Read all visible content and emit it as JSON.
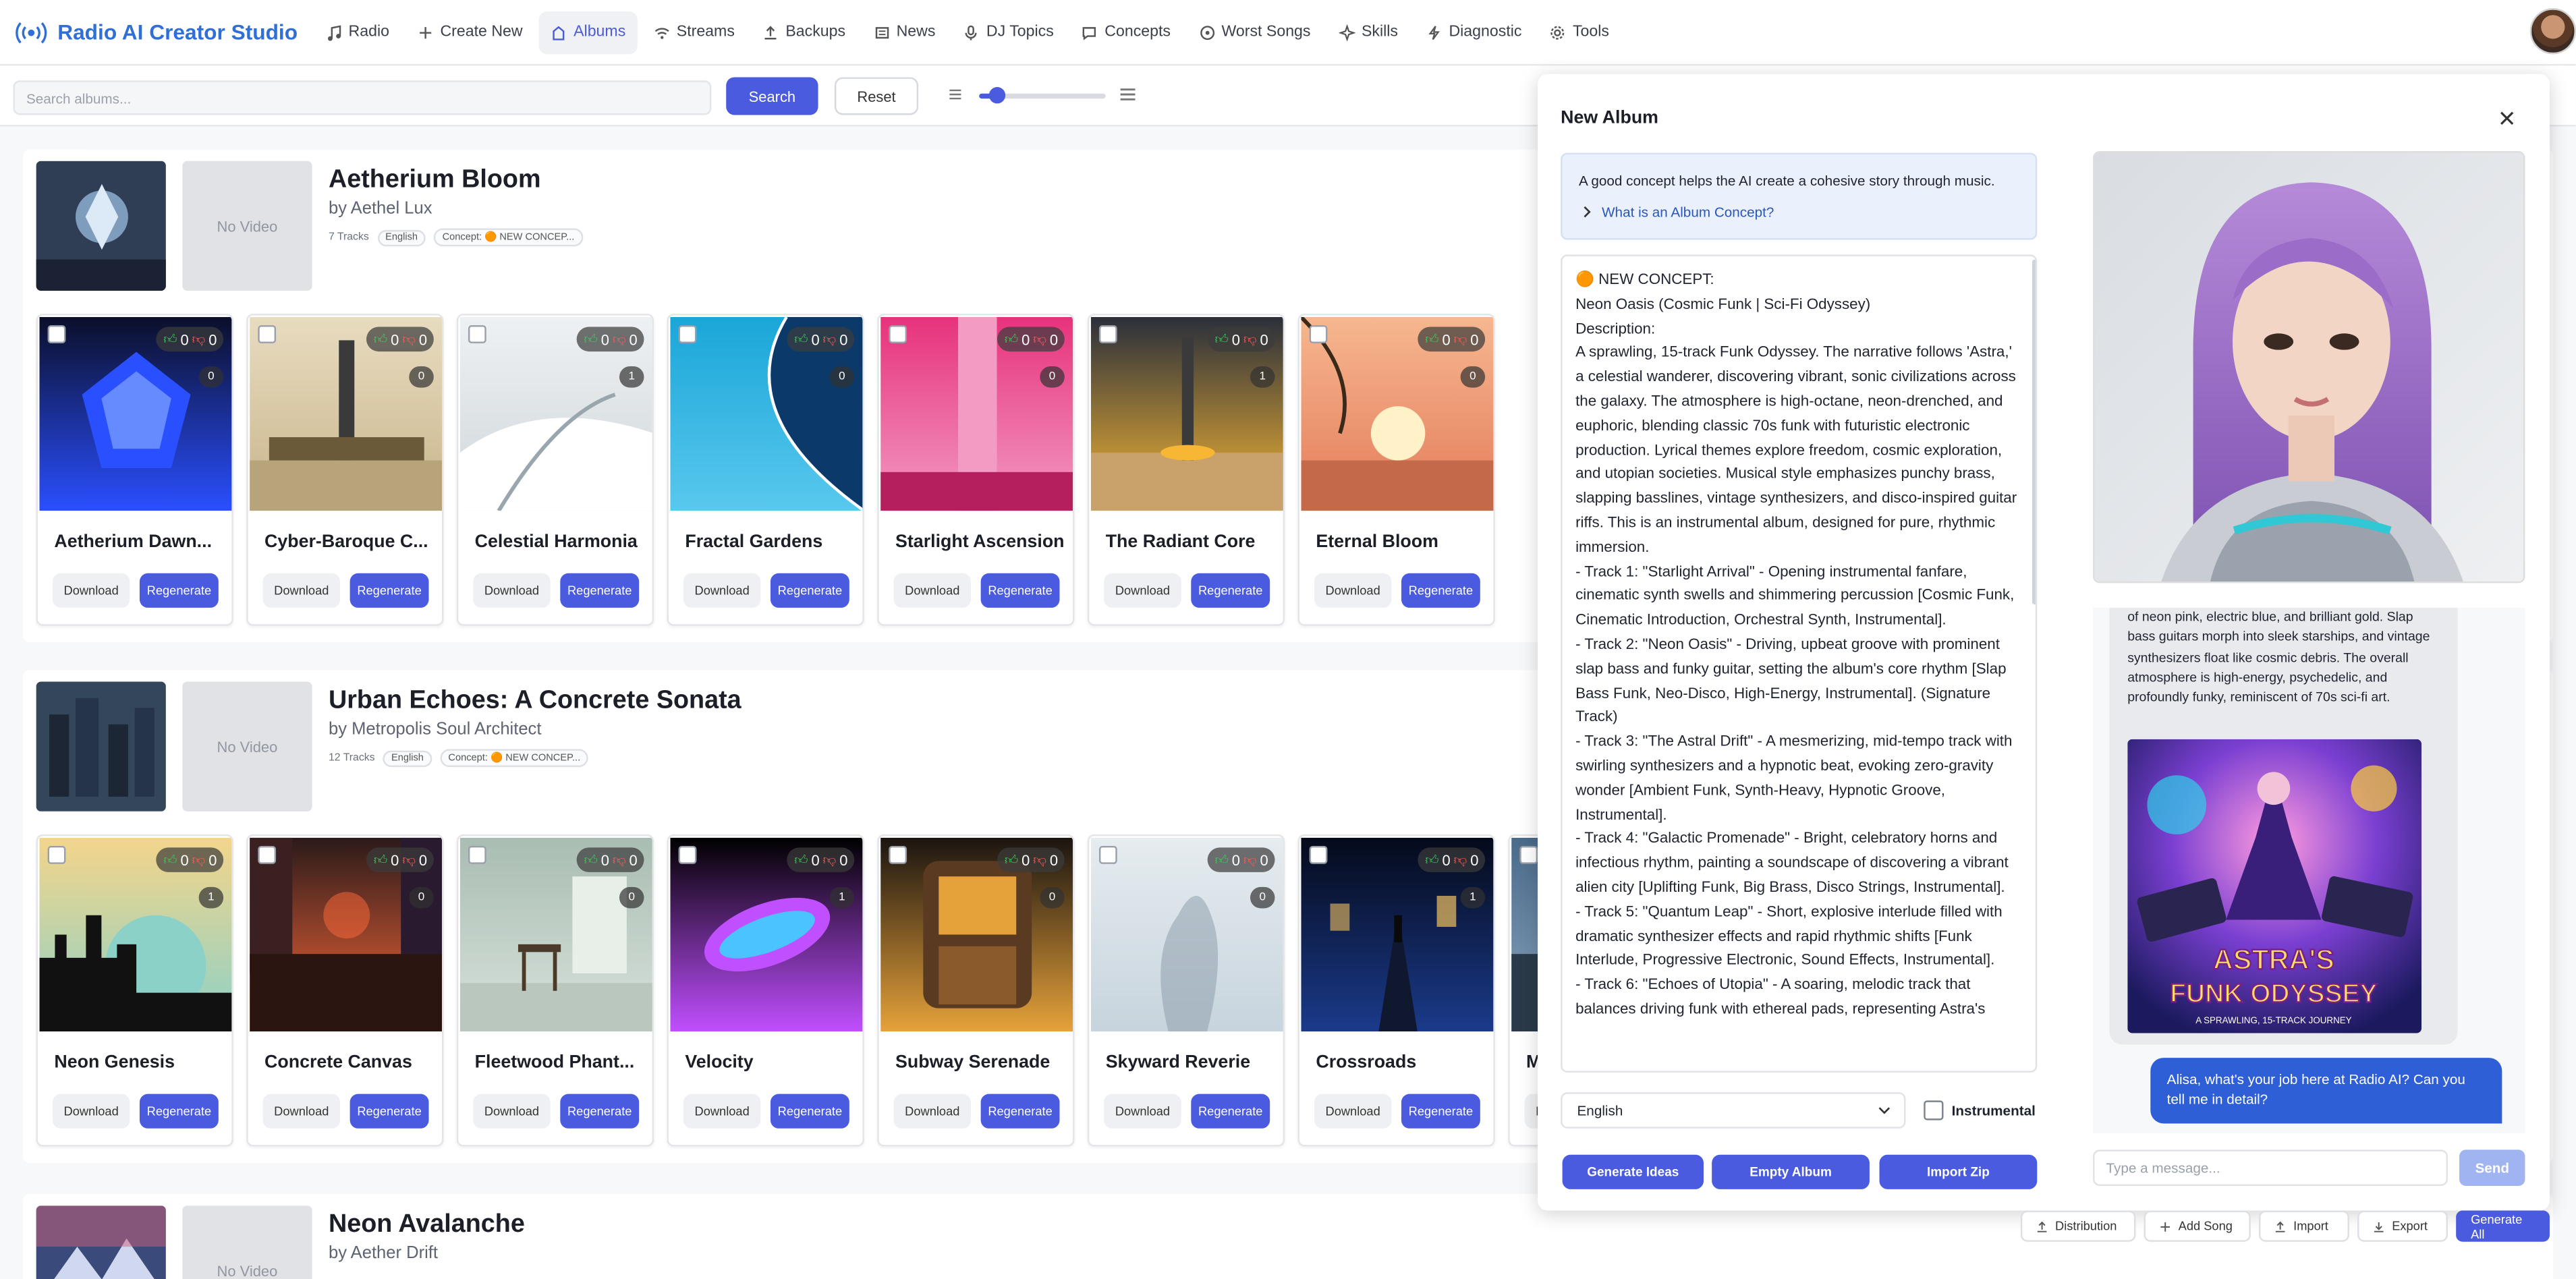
{
  "app": {
    "title": "Radio AI Creator Studio"
  },
  "nav": [
    {
      "label": "Radio",
      "icon": "music-note-icon"
    },
    {
      "label": "Create New",
      "icon": "plus-icon"
    },
    {
      "label": "Albums",
      "icon": "album-icon",
      "active": true
    },
    {
      "label": "Streams",
      "icon": "wifi-icon"
    },
    {
      "label": "Backups",
      "icon": "upload-icon"
    },
    {
      "label": "News",
      "icon": "newspaper-icon"
    },
    {
      "label": "DJ Topics",
      "icon": "microphone-icon"
    },
    {
      "label": "Concepts",
      "icon": "chat-icon"
    },
    {
      "label": "Worst Songs",
      "icon": "target-icon"
    },
    {
      "label": "Skills",
      "icon": "sparkle-icon"
    },
    {
      "label": "Diagnostic",
      "icon": "pulse-icon"
    },
    {
      "label": "Tools",
      "icon": "gear-icon"
    }
  ],
  "search": {
    "placeholder": "Search albums...",
    "value": "",
    "search_label": "Search",
    "reset_label": "Reset",
    "size_slider_value": 0.12
  },
  "albums": [
    {
      "title": "Aetherium Bloom",
      "artist": "by Aethel Lux",
      "tracks_label": "7 Tracks",
      "language": "English",
      "concept_label": "Concept: 🟠 NEW CONCEP...",
      "video_label": "No Video",
      "tracks": [
        {
          "title": "Aetherium Dawn...",
          "likes": "0",
          "dislikes": "0",
          "plays": "0"
        },
        {
          "title": "Cyber-Baroque C...",
          "likes": "0",
          "dislikes": "0",
          "plays": "0"
        },
        {
          "title": "Celestial Harmonia",
          "likes": "0",
          "dislikes": "0",
          "plays": "1"
        },
        {
          "title": "Fractal Gardens",
          "likes": "0",
          "dislikes": "0",
          "plays": "0"
        },
        {
          "title": "Starlight Ascension",
          "likes": "0",
          "dislikes": "0",
          "plays": "0"
        },
        {
          "title": "The Radiant Core",
          "likes": "0",
          "dislikes": "0",
          "plays": "1"
        },
        {
          "title": "Eternal Bloom",
          "likes": "0",
          "dislikes": "0",
          "plays": "0"
        }
      ]
    },
    {
      "title": "Urban Echoes: A Concrete Sonata",
      "artist": "by Metropolis Soul Architect",
      "tracks_label": "12 Tracks",
      "language": "English",
      "concept_label": "Concept: 🟠 NEW CONCEP...",
      "video_label": "No Video",
      "tracks": [
        {
          "title": "Neon Genesis",
          "likes": "0",
          "dislikes": "0",
          "plays": "1"
        },
        {
          "title": "Concrete Canvas",
          "likes": "0",
          "dislikes": "0",
          "plays": "0"
        },
        {
          "title": "Fleetwood Phant...",
          "likes": "0",
          "dislikes": "0",
          "plays": "0"
        },
        {
          "title": "Velocity",
          "likes": "0",
          "dislikes": "0",
          "plays": "1"
        },
        {
          "title": "Subway Serenade",
          "likes": "0",
          "dislikes": "0",
          "plays": "0"
        },
        {
          "title": "Skyward Reverie",
          "likes": "0",
          "dislikes": "0",
          "plays": "0"
        },
        {
          "title": "Crossroads",
          "likes": "0",
          "dislikes": "0",
          "plays": "1"
        },
        {
          "title": "M",
          "likes": "",
          "dislikes": "",
          "plays": ""
        }
      ]
    },
    {
      "title": "Neon Avalanche",
      "artist": "by Aether Drift",
      "video_label": "No Video",
      "tracks": []
    }
  ],
  "track_actions": {
    "download_label": "Download",
    "regenerate_label": "Regenerate"
  },
  "modal": {
    "title": "New Album",
    "info_text": "A good concept helps the AI create a cohesive story through music.",
    "info_link": "What is an Album Concept?",
    "concept_text": "🟠 NEW CONCEPT:\nNeon Oasis (Cosmic Funk | Sci-Fi Odyssey)\nDescription:\nA sprawling, 15-track Funk Odyssey. The narrative follows 'Astra,' a celestial wanderer, discovering vibrant, sonic civilizations across the galaxy. The atmosphere is high-octane, neon-drenched, and euphoric, blending classic 70s funk with futuristic electronic production. Lyrical themes explore freedom, cosmic exploration, and utopian societies. Musical style emphasizes punchy brass, slapping basslines, vintage synthesizers, and disco-inspired guitar riffs. This is an instrumental album, designed for pure, rhythmic immersion.\n- Track 1: \"Starlight Arrival\" - Opening instrumental fanfare, cinematic synth swells and shimmering percussion [Cosmic Funk, Cinematic Introduction, Orchestral Synth, Instrumental].\n- Track 2: \"Neon Oasis\" - Driving, upbeat groove with prominent slap bass and funky guitar, setting the album's core rhythm [Slap Bass Funk, Neo-Disco, High-Energy, Instrumental]. (Signature Track)\n- Track 3: \"The Astral Drift\" - A mesmerizing, mid-tempo track with swirling synthesizers and a hypnotic beat, evoking zero-gravity wonder [Ambient Funk, Synth-Heavy, Hypnotic Groove, Instrumental].\n- Track 4: \"Galactic Promenade\" - Bright, celebratory horns and infectious rhythm, painting a soundscape of discovering a vibrant alien city [Uplifting Funk, Big Brass, Disco Strings, Instrumental].\n- Track 5: \"Quantum Leap\" - Short, explosive interlude filled with dramatic synthesizer effects and rapid rhythmic shifts [Funk Interlude, Progressive Electronic, Sound Effects, Instrumental].\n- Track 6: \"Echoes of Utopia\" - A soaring, melodic track that balances driving funk with ethereal pads, representing Astra's",
    "language": "English",
    "instrumental_label": "Instrumental",
    "instrumental_checked": false,
    "generate_ideas_label": "Generate Ideas",
    "empty_album_label": "Empty Album",
    "import_zip_label": "Import Zip"
  },
  "chat": {
    "ai_message": "of neon pink, electric blue, and brilliant gold. Slap bass guitars morph into sleek starships, and vintage synthesizers float like cosmic debris. The overall atmosphere is high-energy, psychedelic, and profoundly funky, reminiscent of 70s sci-fi art.",
    "poster_title_1": "ASTRA'S",
    "poster_title_2": "FUNK ODYSSEY",
    "poster_subtitle": "A SPRAWLING, 15-TRACK JOURNEY",
    "user_message": "Alisa, what's your job here at Radio AI? Can you tell me in detail?",
    "input_placeholder": "Type a message...",
    "send_label": "Send"
  },
  "bottom_bar": [
    {
      "label": "Distribution",
      "icon": "upload-icon"
    },
    {
      "label": "Add Song",
      "icon": "plus-icon"
    },
    {
      "label": "Import",
      "icon": "upload-icon"
    },
    {
      "label": "Export",
      "icon": "download-icon"
    },
    {
      "label": "Generate All",
      "icon": ""
    }
  ],
  "colors": {
    "accent": "#4a5be0",
    "brand": "#2f6fd6",
    "like": "#3ccf5a",
    "dislike": "#ff5a5a"
  }
}
